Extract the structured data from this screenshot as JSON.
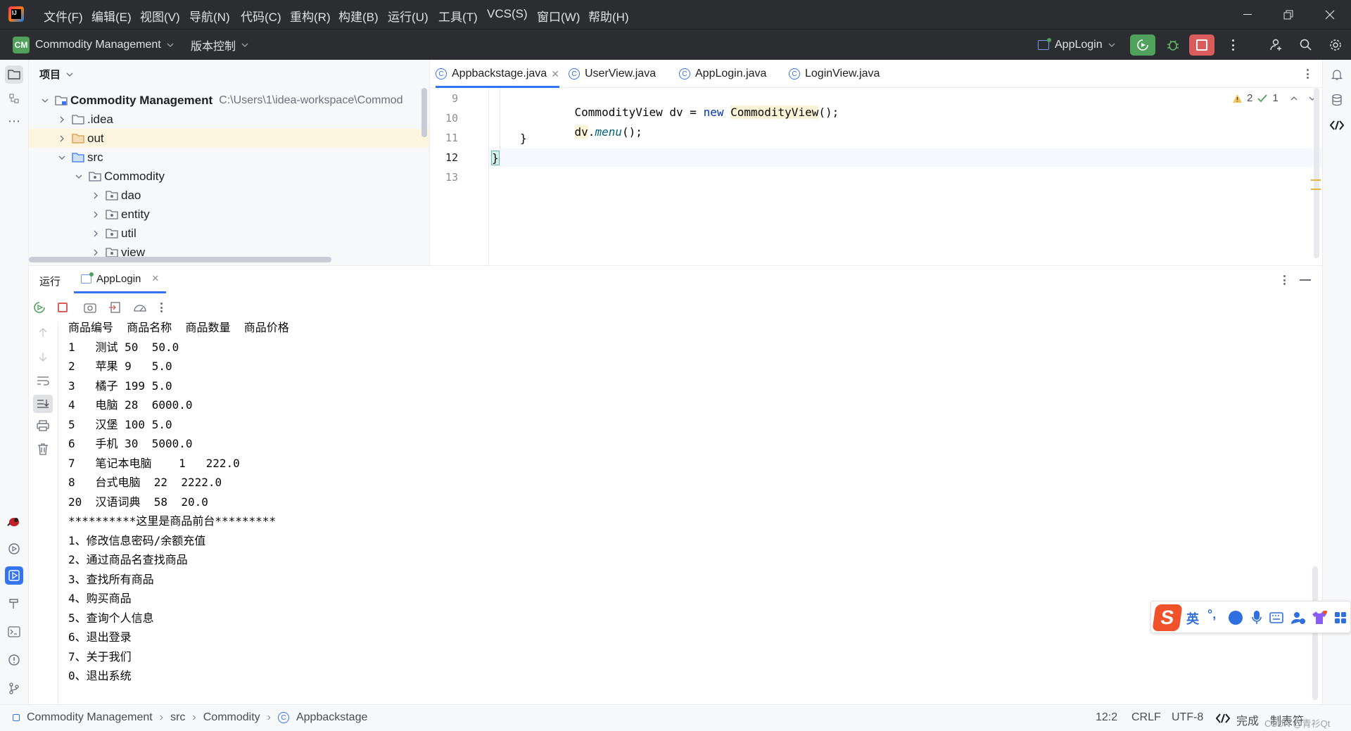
{
  "window": {
    "menu": [
      "文件(F)",
      "编辑(E)",
      "视图(V)",
      "导航(N)",
      "代码(C)",
      "重构(R)",
      "构建(B)",
      "运行(U)",
      "工具(T)",
      "VCS(S)",
      "窗口(W)",
      "帮助(H)"
    ]
  },
  "toolbar": {
    "project_badge": "CM",
    "project_name": "Commodity Management",
    "vcs_label": "版本控制",
    "run_config": "AppLogin"
  },
  "project_panel": {
    "title": "项目",
    "root_name": "Commodity Management",
    "root_path": "C:\\Users\\1\\idea-workspace\\Commod",
    "items": [
      ".idea",
      "out",
      "src",
      "Commodity",
      "dao",
      "entity",
      "util",
      "view"
    ]
  },
  "editor": {
    "tabs": [
      "Appbackstage.java",
      "UserView.java",
      "AppLogin.java",
      "LoginView.java"
    ],
    "line_numbers": [
      "9",
      "10",
      "11",
      "12",
      "13"
    ],
    "code": {
      "l9_type": "CommodityView",
      "l9_var": " dv = ",
      "l9_new": "new",
      "l9_ctor": "CommodityView",
      "l9_end": "();",
      "l10_obj": "dv",
      "l10_dot": ".",
      "l10_method": "menu",
      "l10_end": "();",
      "l11": "}",
      "l12": "}"
    },
    "inspections": {
      "warnings": "2",
      "ok": "1"
    }
  },
  "run_panel": {
    "tab_run": "运行",
    "tab_app": "AppLogin",
    "console_lines": [
      "商品编号  商品名称  商品数量  商品价格",
      "1   测试 50  50.0",
      "2   苹果 9   5.0",
      "3   橘子 199 5.0",
      "4   电脑 28  6000.0",
      "5   汉堡 100 5.0",
      "6   手机 30  5000.0",
      "7   笔记本电脑    1   222.0",
      "8   台式电脑  22  2222.0",
      "20  汉语词典  58  20.0",
      "**********这里是商品前台*********",
      "1、修改信息密码/余额充值",
      "2、通过商品名查找商品",
      "3、查找所有商品",
      "4、购买商品",
      "5、查询个人信息",
      "6、退出登录",
      "7、关于我们",
      "0、退出系统"
    ]
  },
  "statusbar": {
    "breadcrumb": [
      "Commodity Management",
      "src",
      "Commodity",
      "Appbackstage"
    ],
    "position": "12:2",
    "line_sep": "CRLF",
    "encoding": "UTF-8",
    "status": "完成",
    "indent": "制表符",
    "watermark": "CSDN @青衫Qt"
  },
  "ime": {
    "lang": "英"
  },
  "colors": {
    "accent": "#3574f0",
    "run_green": "#4fa15c",
    "stop_red": "#db5c5c",
    "highlight_row": "#fdf5dd"
  }
}
